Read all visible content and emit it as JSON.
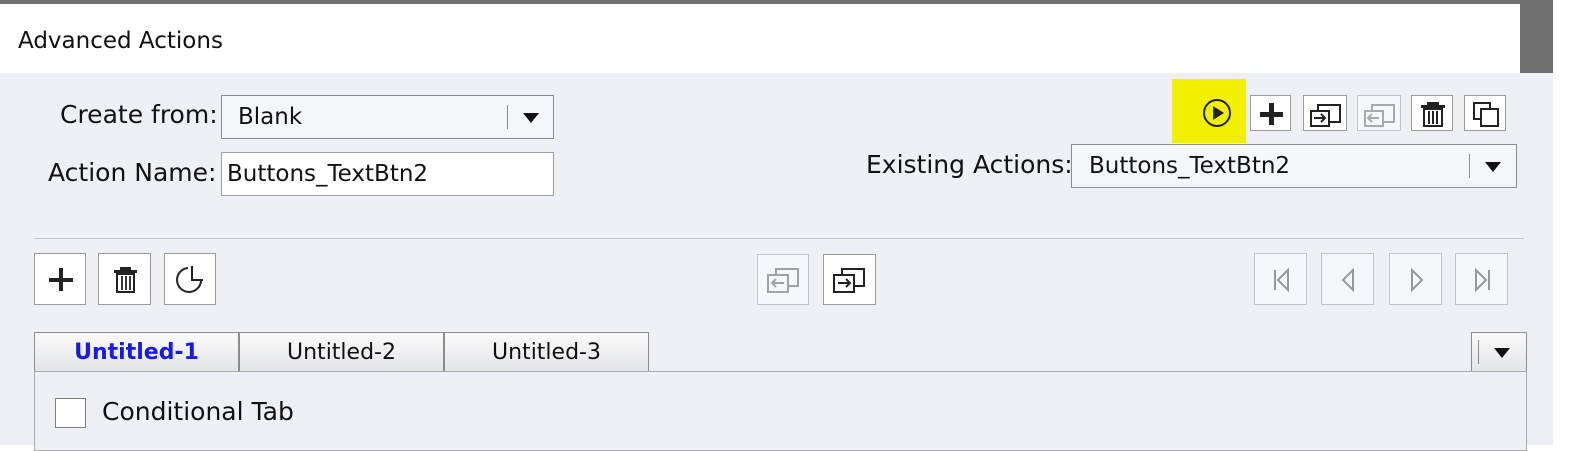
{
  "window": {
    "title": "Advanced Actions"
  },
  "form": {
    "create_from_label": "Create from:",
    "create_from_value": "Blank",
    "action_name_label": "Action Name:",
    "action_name_value": "Buttons_TextBtn2",
    "existing_actions_label": "Existing Actions:",
    "existing_actions_value": "Buttons_TextBtn2"
  },
  "top_toolbar": {
    "icons": [
      "preview-icon",
      "add-action-icon",
      "import-icon",
      "export-icon",
      "delete-action-icon",
      "duplicate-action-icon"
    ],
    "highlight_color": "#f0f000"
  },
  "action_toolbar": {
    "icons": [
      "add-icon",
      "delete-icon",
      "copy-icon",
      "cut-icon",
      "paste-icon",
      "first-icon",
      "previous-icon",
      "next-icon",
      "last-icon"
    ]
  },
  "tabs": [
    {
      "label": "Untitled-1",
      "active": true
    },
    {
      "label": "Untitled-2",
      "active": false
    },
    {
      "label": "Untitled-3",
      "active": false
    }
  ],
  "conditional": {
    "label": "Conditional Tab",
    "checked": false
  },
  "colors": {
    "active_tab_text": "#1a1ae6",
    "panel_bg": "#eef0f5"
  }
}
